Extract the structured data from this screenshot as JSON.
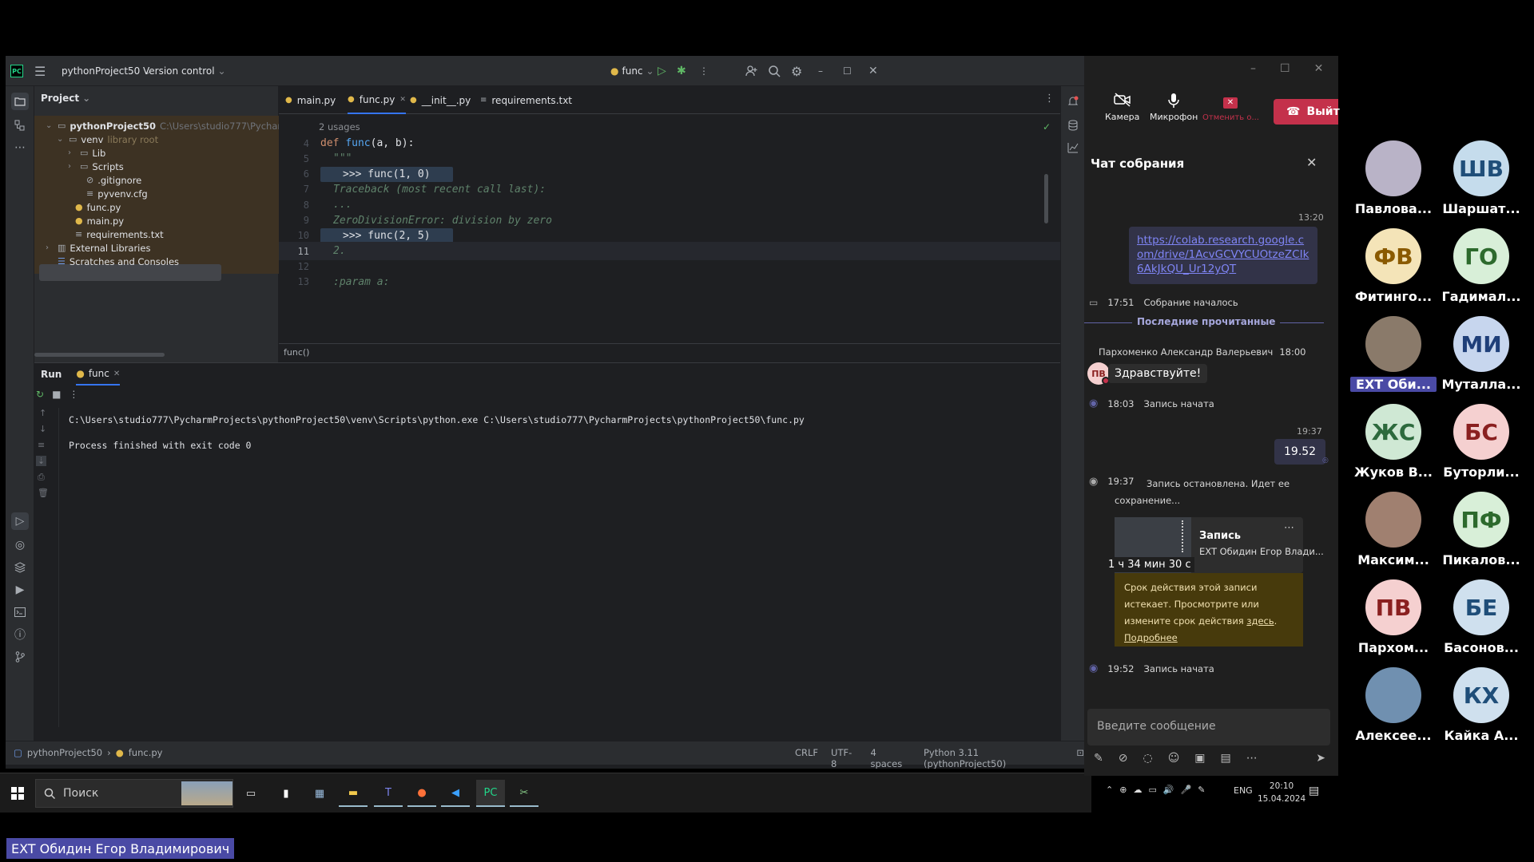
{
  "ide": {
    "project_name": "pythonProject50",
    "version_control": "Version control",
    "run_config": "func",
    "project_label": "Project",
    "tree": [
      {
        "label": "pythonProject50",
        "extra": "C:\\Users\\studio777\\PycharmP",
        "icon": "folder-icon"
      },
      {
        "label": "venv",
        "extra": "library root",
        "icon": "folder-icon"
      },
      {
        "label": "Lib",
        "extra": "",
        "icon": "folder-icon"
      },
      {
        "label": "Scripts",
        "extra": "",
        "icon": "folder-icon"
      },
      {
        "label": ".gitignore",
        "extra": "",
        "icon": "ignore-file-icon"
      },
      {
        "label": "pyvenv.cfg",
        "extra": "",
        "icon": "config-file-icon"
      },
      {
        "label": "func.py",
        "extra": "",
        "icon": "python-file-icon"
      },
      {
        "label": "main.py",
        "extra": "",
        "icon": "python-file-icon"
      },
      {
        "label": "requirements.txt",
        "extra": "",
        "icon": "text-file-icon"
      },
      {
        "label": "External Libraries",
        "extra": "",
        "icon": "library-icon"
      },
      {
        "label": "Scratches and Consoles",
        "extra": "",
        "icon": "scratches-icon"
      }
    ],
    "tabs": [
      {
        "label": "main.py"
      },
      {
        "label": "func.py"
      },
      {
        "label": "__init__.py"
      },
      {
        "label": "requirements.txt"
      }
    ],
    "usages": "2 usages",
    "code": [
      {
        "ln": "4",
        "text": ""
      },
      {
        "ln": "5",
        "text": "\"\"\""
      },
      {
        "ln": "6",
        "text": ""
      },
      {
        "ln": "7",
        "text": "Traceback (most recent call last):"
      },
      {
        "ln": "8",
        "text": "..."
      },
      {
        "ln": "9",
        "text": "ZeroDivisionError: division by zero"
      },
      {
        "ln": "10",
        "text": ""
      },
      {
        "ln": "11",
        "text": "2."
      },
      {
        "ln": "12",
        "text": ""
      },
      {
        "ln": "13",
        "text": ":param a:"
      }
    ],
    "code_def_kw": "def",
    "code_def_name": "func",
    "code_def_args": "(a, b):",
    "code_call1": ">>> func(1, 0)",
    "code_call2": ">>> func(2, 5)",
    "breadcrumb_fn": "func()",
    "run_tab": "Run",
    "run_config_tab": "func",
    "console_cmd": "C:\\Users\\studio777\\PycharmProjects\\pythonProject50\\venv\\Scripts\\python.exe C:\\Users\\studio777\\PycharmProjects\\pythonProject50\\func.py",
    "console_exit": "Process finished with exit code 0",
    "status": {
      "crumb_project": "pythonProject50",
      "crumb_file": "func.py",
      "line_sep": "CRLF",
      "encoding": "UTF-8",
      "indent": "4 spaces",
      "interpreter": "Python 3.11 (pythonProject50)"
    }
  },
  "taskbar": {
    "search_placeholder": "Поиск",
    "lang": "ENG",
    "time": "20:10",
    "date": "15.04.2024"
  },
  "teams": {
    "camera": "Камера",
    "mic": "Микрофон",
    "share": "Отменить о...",
    "leave": "Выйт",
    "chat_title": "Чат собрания",
    "msg1_time": "13:20",
    "msg1_link": "https://colab.research.google.com/drive/1AcvGCVYCUOtzeZCIk6AkJkQU_Ur12yQT",
    "event1_time": "17:51",
    "event1_text": "Собрание началось",
    "last_read": "Последние прочитанные",
    "sender": "Пархоменко Александр Валерьевич",
    "sender_time": "18:00",
    "sender_initials": "ПВ",
    "sender_msg": "Здравствуйте!",
    "event2_time": "18:03",
    "event2_text": "Запись начата",
    "msg2_time": "19:37",
    "msg2_text": "19.52",
    "event3_time": "19:37",
    "event3_text": "Запись остановлена. Идет ее сохранение...",
    "rec_title": "Запись",
    "rec_author": "EXT Обидин Егор Влади...",
    "rec_duration": "1 ч 34 мин 30 с",
    "warn_text": "Срок действия этой записи истекает. Просмотрите или измените срок действия",
    "warn_link": "здесь",
    "warn_more": "Подробнее",
    "event4_time": "19:52",
    "event4_text": "Запись начата",
    "input_placeholder": "Введите сообщение"
  },
  "participants": [
    {
      "initials": "",
      "name": "Павлова...",
      "bg": "#b9b3c7",
      "fg": "#333"
    },
    {
      "initials": "ШВ",
      "name": "Шаршат...",
      "bg": "#c5dcec",
      "fg": "#1f4e79"
    },
    {
      "initials": "ФВ",
      "name": "Фитинго...",
      "bg": "#f4e4b8",
      "fg": "#8a5a00"
    },
    {
      "initials": "ГО",
      "name": "Гадимал...",
      "bg": "#d8efd8",
      "fg": "#2d6a2d"
    },
    {
      "initials": "",
      "name": "EXT Оби...",
      "bg": "#8a7a6a",
      "fg": "#fff"
    },
    {
      "initials": "МИ",
      "name": "Муталла...",
      "bg": "#c7d6ee",
      "fg": "#1f3f79"
    },
    {
      "initials": "ЖС",
      "name": "Жуков В...",
      "bg": "#cfe8d4",
      "fg": "#2d6a3d"
    },
    {
      "initials": "БС",
      "name": "Буторли...",
      "bg": "#f5d0d0",
      "fg": "#8a2020"
    },
    {
      "initials": "",
      "name": "Максим...",
      "bg": "#a08070",
      "fg": "#fff"
    },
    {
      "initials": "ПФ",
      "name": "Пикалов...",
      "bg": "#d8efd8",
      "fg": "#2d6a2d"
    },
    {
      "initials": "ПВ",
      "name": "Пархом...",
      "bg": "#f5d0d0",
      "fg": "#8a2020"
    },
    {
      "initials": "БЕ",
      "name": "Басонов...",
      "bg": "#cfe0ee",
      "fg": "#1f4e79"
    },
    {
      "initials": "",
      "name": "Алексее...",
      "bg": "#7090b0",
      "fg": "#fff"
    },
    {
      "initials": "КХ",
      "name": "Кайка А...",
      "bg": "#cfe0ee",
      "fg": "#1f4e79"
    }
  ],
  "speaker_label": "EXT Обидин Егор Владимирович",
  "colors": {
    "accent": "#3574f0",
    "teams_purple": "#6264a7",
    "leave_red": "#c4314b"
  }
}
